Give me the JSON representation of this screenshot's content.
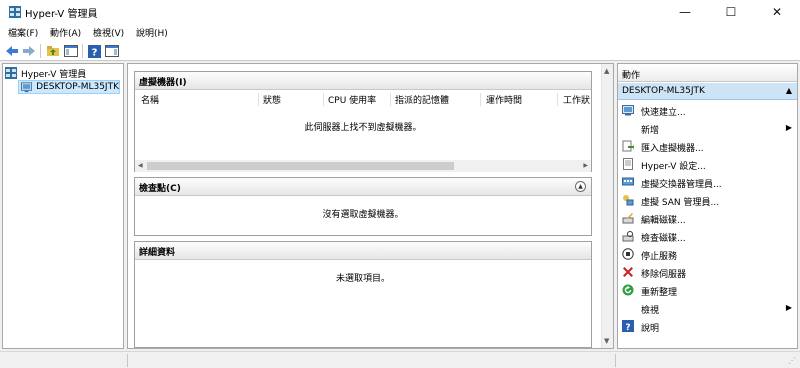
{
  "window": {
    "title": "Hyper-V 管理員",
    "min_glyph": "—",
    "max_glyph": "☐",
    "close_glyph": "✕"
  },
  "menu": [
    "檔案(F)",
    "動作(A)",
    "檢視(V)",
    "說明(H)"
  ],
  "toolbar": [
    "back-arrow-icon",
    "forward-arrow-icon",
    "up-folder-icon",
    "show-hide-tree-icon",
    "help-icon",
    "show-hide-action-pane-icon"
  ],
  "tree": {
    "root": "Hyper-V 管理員",
    "server": "DESKTOP-ML35JTK"
  },
  "vms": {
    "title": "虛擬機器(I)",
    "columns": [
      "名稱",
      "狀態",
      "CPU 使用率",
      "指派的記憶體",
      "運作時間",
      "工作狀"
    ],
    "empty": "此伺服器上找不到虛擬機器。"
  },
  "checkpoints": {
    "title": "檢查點(C)",
    "empty": "沒有選取虛擬機器。"
  },
  "details": {
    "title": "詳細資料",
    "empty": "未選取項目。"
  },
  "actions": {
    "title": "動作",
    "group": "DESKTOP-ML35JTK",
    "items": [
      {
        "label": "快速建立...",
        "icon": "quick-create-icon"
      },
      {
        "label": "新增",
        "icon": "",
        "submenu": "▶"
      },
      {
        "label": "匯入虛擬機器...",
        "icon": "import-vm-icon"
      },
      {
        "label": "Hyper-V 設定...",
        "icon": "settings-icon"
      },
      {
        "label": "虛擬交換器管理員...",
        "icon": "switch-manager-icon"
      },
      {
        "label": "虛擬 SAN 管理員...",
        "icon": "san-manager-icon"
      },
      {
        "label": "編輯磁碟...",
        "icon": "edit-disk-icon"
      },
      {
        "label": "檢查磁碟...",
        "icon": "inspect-disk-icon"
      },
      {
        "label": "停止服務",
        "icon": "stop-service-icon"
      },
      {
        "label": "移除伺服器",
        "icon": "remove-server-icon"
      },
      {
        "label": "重新整理",
        "icon": "refresh-icon"
      },
      {
        "label": "檢視",
        "icon": "",
        "submenu": "▶"
      },
      {
        "label": "說明",
        "icon": "help-icon"
      }
    ]
  }
}
